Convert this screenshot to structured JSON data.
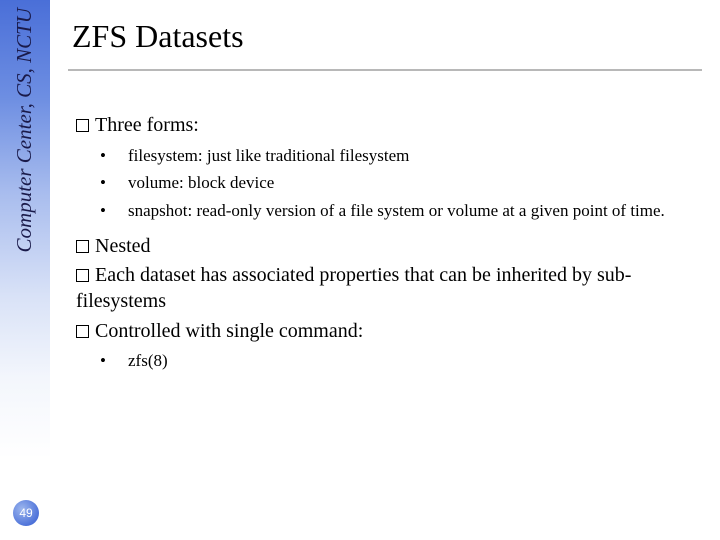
{
  "sidebar": {
    "label": "Computer Center, CS, NCTU"
  },
  "page_number": "49",
  "title": "ZFS Datasets",
  "body": {
    "item1": {
      "label": "Three forms:",
      "sub": [
        "filesystem: just like traditional filesystem",
        "volume: block device",
        "snapshot: read-only version of a file system or volume at a given point of time."
      ]
    },
    "item2": {
      "label": "Nested"
    },
    "item3": {
      "label": "Each dataset has associated properties that can be inherited by sub-filesystems"
    },
    "item4": {
      "label": "Controlled with single command:",
      "sub": [
        "zfs(8)"
      ]
    }
  }
}
